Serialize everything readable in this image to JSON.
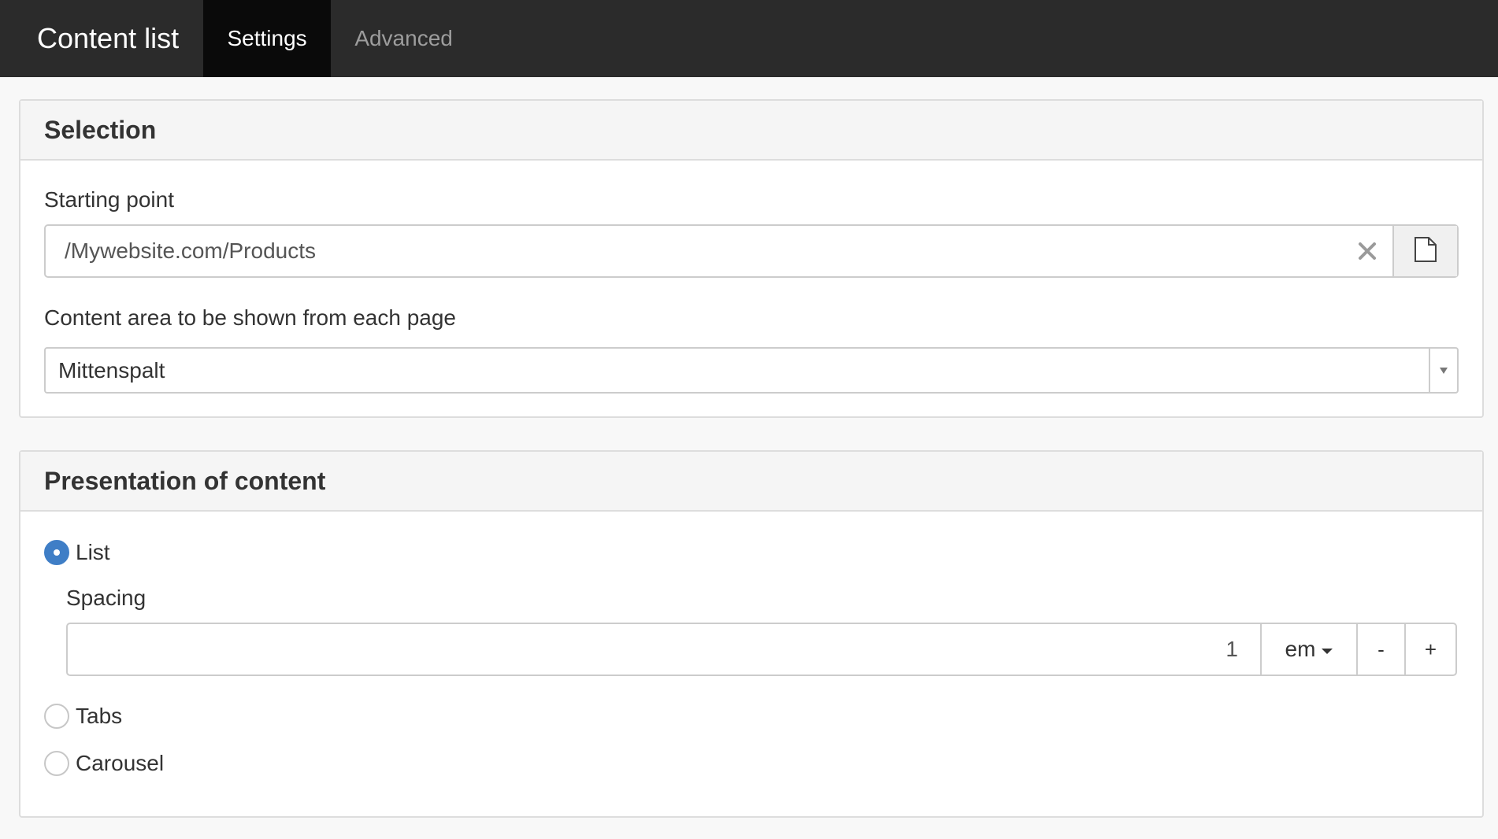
{
  "header": {
    "title": "Content list",
    "tabs": [
      {
        "label": "Settings",
        "active": true
      },
      {
        "label": "Advanced",
        "active": false
      }
    ]
  },
  "selection": {
    "heading": "Selection",
    "starting_point": {
      "label": "Starting point",
      "value": "/Mywebsite.com/Products",
      "clear_icon": "close-icon",
      "browse_icon": "file-icon"
    },
    "content_area": {
      "label": "Content area to be shown from each page",
      "value": "Mittenspalt"
    }
  },
  "presentation": {
    "heading": "Presentation of content",
    "options": [
      {
        "label": "List",
        "checked": true
      },
      {
        "label": "Tabs",
        "checked": false
      },
      {
        "label": "Carousel",
        "checked": false
      }
    ],
    "spacing": {
      "label": "Spacing",
      "value": "1",
      "unit": "em",
      "decrement": "-",
      "increment": "+"
    }
  },
  "colors": {
    "topbar": "#2b2b2b",
    "active_tab": "#0a0a0a",
    "radio_checked": "#3f7ec6"
  }
}
